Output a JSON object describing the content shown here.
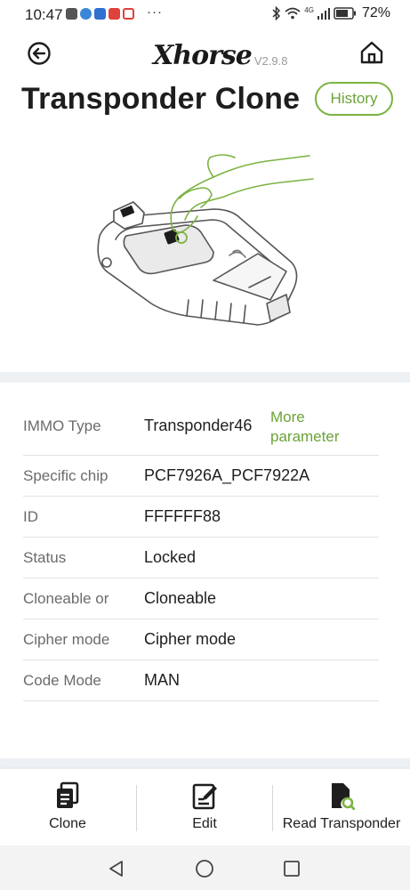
{
  "status_bar": {
    "time": "10:47",
    "dots": "···",
    "battery_percent": "72%",
    "network_label": "4G"
  },
  "header": {
    "logo_text": "Xhorse",
    "version": "V2.9.8",
    "title": "Transponder Clone",
    "history_label": "History"
  },
  "info": {
    "more_parameter": "More parameter",
    "rows": [
      {
        "label": "IMMO Type",
        "value": "Transponder46"
      },
      {
        "label": "Specific chip",
        "value": "PCF7926A_PCF7922A"
      },
      {
        "label": "ID",
        "value": "FFFFFF88"
      },
      {
        "label": "Status",
        "value": "Locked"
      },
      {
        "label": "Cloneable or",
        "value": "Cloneable"
      },
      {
        "label": "Cipher mode",
        "value": "Cipher mode"
      },
      {
        "label": "Code Mode",
        "value": "MAN"
      }
    ]
  },
  "actions": {
    "clone_label": "Clone",
    "edit_label": "Edit",
    "read_label": "Read Transponder"
  },
  "colors": {
    "accent": "#7cb342",
    "accent_text": "#6aa336",
    "separator": "#eef1f4"
  },
  "icons": {
    "back": "back-arrow-icon",
    "home": "home-icon",
    "clone": "clone-icon",
    "edit": "edit-icon",
    "read": "read-transponder-icon"
  }
}
